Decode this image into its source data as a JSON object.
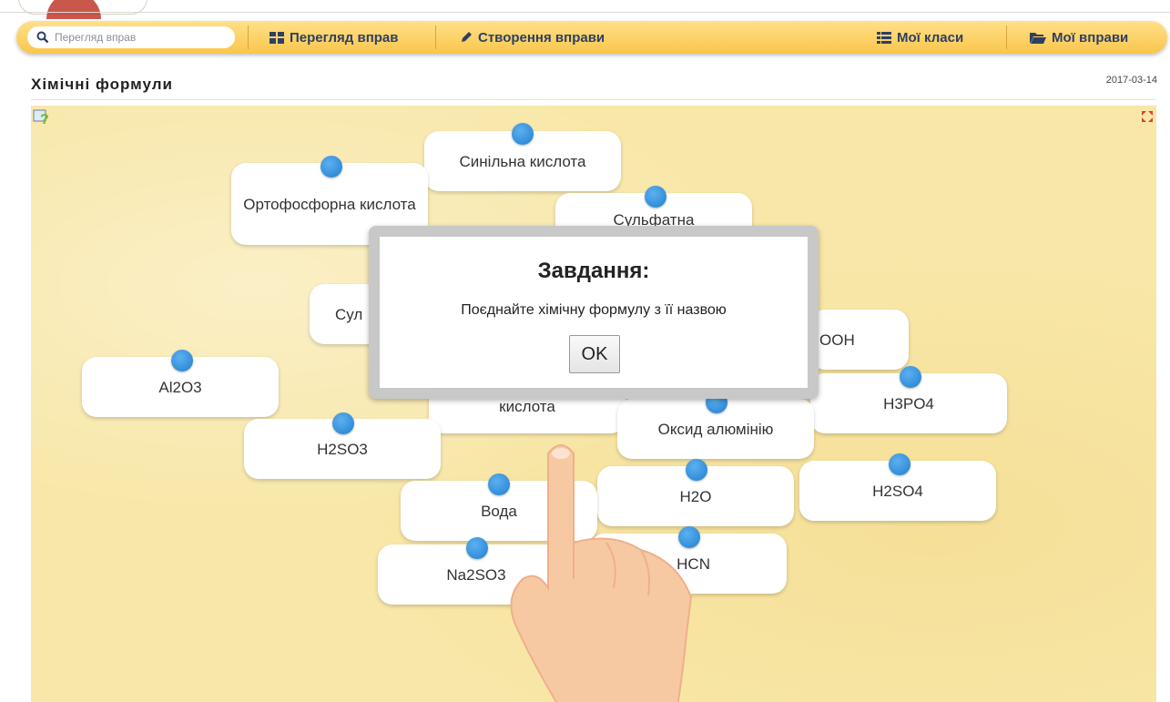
{
  "search": {
    "placeholder": "Перегляд вправ"
  },
  "nav": {
    "browse_label": "Перегляд вправ",
    "create_label": "Створення вправи",
    "classes_label": "Мої класи",
    "exercises_label": "Мої вправи"
  },
  "header": {
    "title": "Хімічні формули",
    "date": "2017-03-14"
  },
  "cards": [
    "Синільна кислота",
    "Ортофосфорна кислота",
    "Сульфатна",
    "Сул",
    "ООН",
    "Al2O3",
    "кислота",
    "H3PO4",
    "Оксид алюмінію",
    "H2SO3",
    "H2SO4",
    "H2O",
    "Вода",
    "HCN",
    "Na2SO3"
  ],
  "modal": {
    "title": "Завдання:",
    "text": "Поєднайте хімічну формулу з її назвою",
    "ok_label": "OK"
  },
  "colors": {
    "navbar": "#f9c64a",
    "stage": "#f8e7a8",
    "dot": "#2a8ad8",
    "nav_text": "#2d3f63"
  }
}
